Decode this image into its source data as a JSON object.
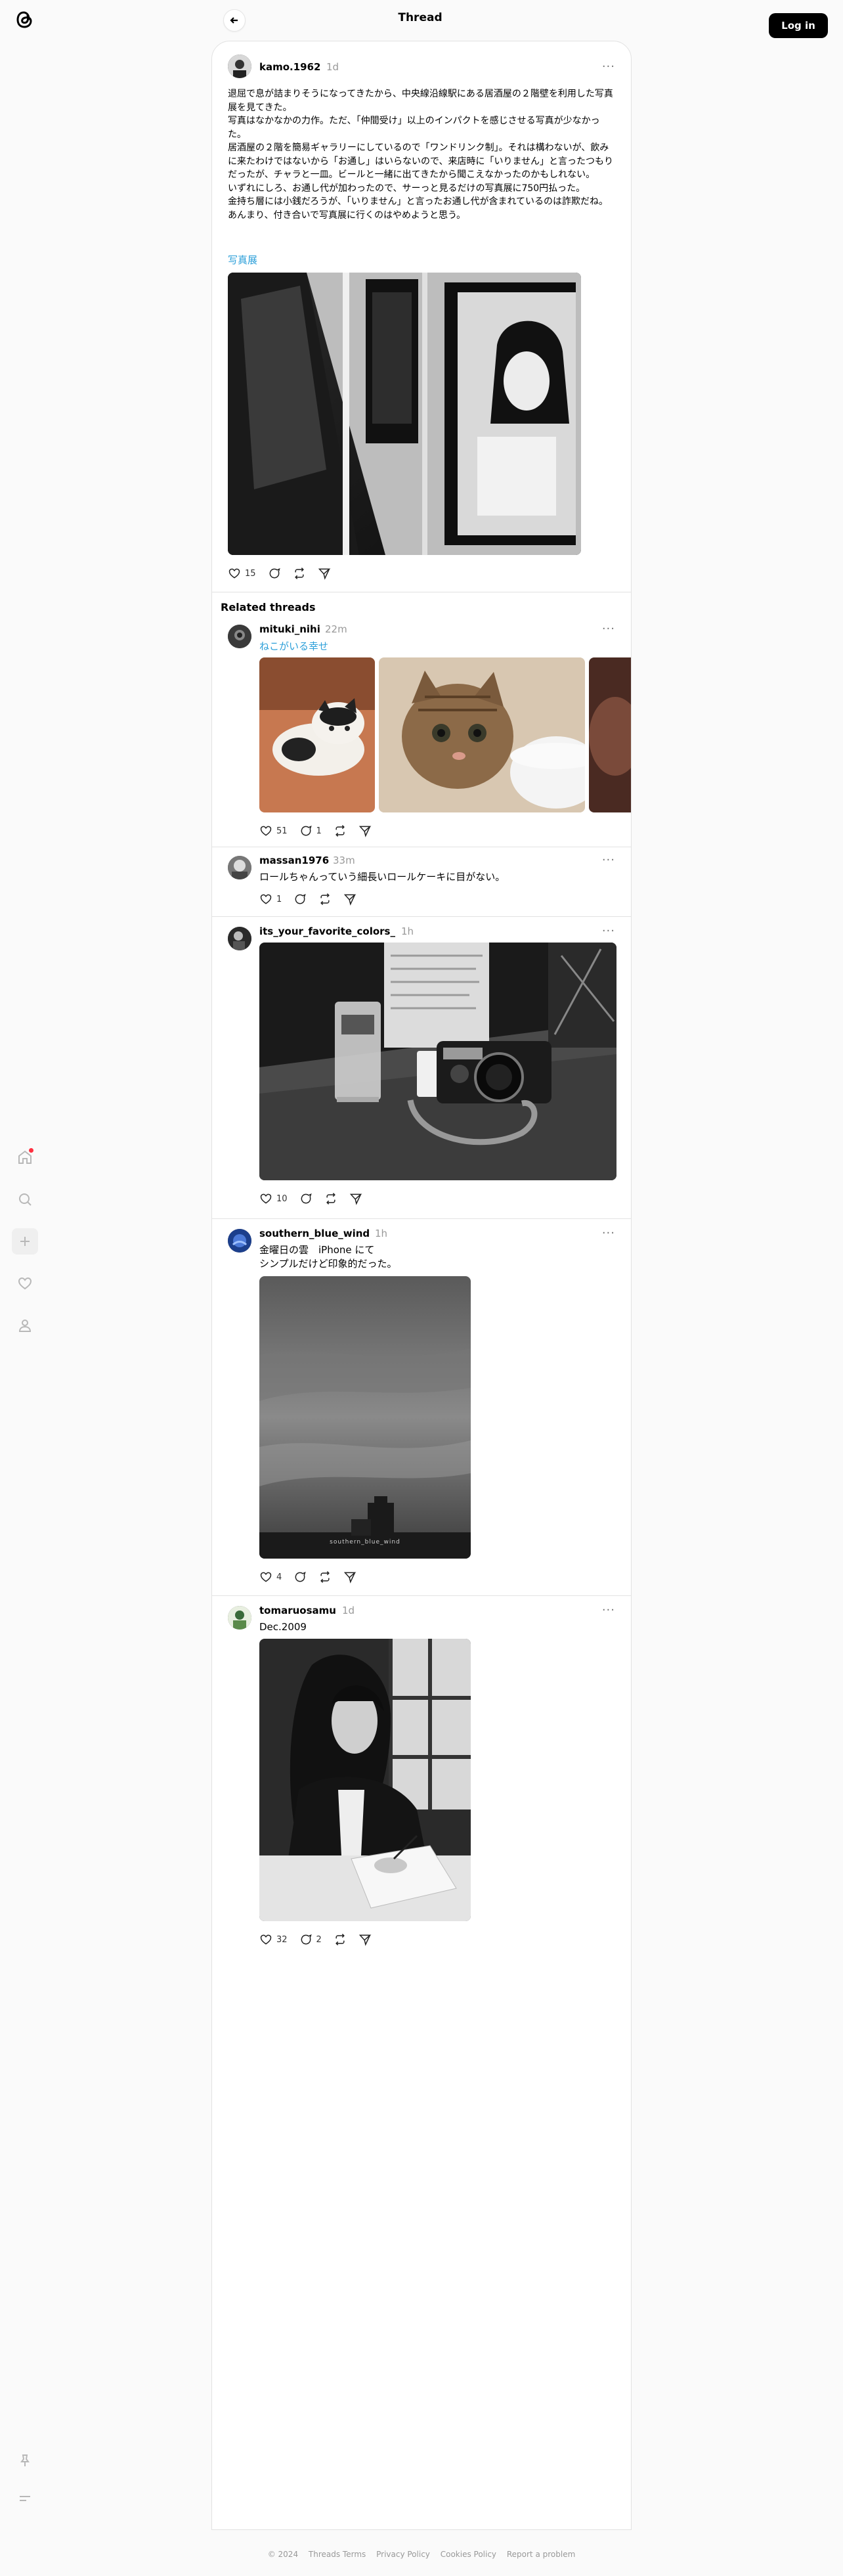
{
  "header": {
    "title": "Thread",
    "login_label": "Log in"
  },
  "rail": {
    "items": [
      "home-icon",
      "search-icon",
      "plus-icon",
      "heart-icon",
      "profile-icon"
    ],
    "bottom": [
      "pin-icon",
      "menu-icon"
    ]
  },
  "main_post": {
    "username": "kamo.1962",
    "time": "1d",
    "text": "退屈で息が詰まりそうになってきたから、中央線沿線駅にある居酒屋の２階壁を利用した写真展を見てきた。\n写真はなかなかの力作。ただ、「仲間受け」以上のインパクトを感じさせる写真が少なかった。\n居酒屋の２階を簡易ギャラリーにしているので「ワンドリンク制」。それは構わないが、飲みに来たわけではないから「お通し」はいらないので、来店時に「いりません」と言ったつもりだったが、チャラと一皿。ビールと一緒に出てきたから聞こえなかったのかもしれない。\nいずれにしろ、お通し代が加わったので、サーっと見るだけの写真展に750円払った。\n金持ち層には小銭だろうが、「いりません」と言ったお通し代が含まれているのは詐欺だね。\nあんまり、付き合いで写真展に行くのはやめようと思う。",
    "tag": "写真展",
    "likes": "15"
  },
  "related": {
    "title": "Related threads",
    "posts": [
      {
        "username": "mituki_nihi",
        "time": "22m",
        "tag": "ねこがいる幸せ",
        "likes": "51",
        "replies": "1"
      },
      {
        "username": "massan1976",
        "time": "33m",
        "text": "ロールちゃんっていう細長いロールケーキに目がない。",
        "likes": "1"
      },
      {
        "username": "its_your_favorite_colors_",
        "time": "1h",
        "likes": "10"
      },
      {
        "username": "southern_blue_wind",
        "time": "1h",
        "text": "金曜日の雲　iPhone にて\nシンプルだけど印象的だった。",
        "likes": "4",
        "watermark": "southern_blue_wind"
      },
      {
        "username": "tomaruosamu",
        "time": "1d",
        "text": "Dec.2009",
        "likes": "32",
        "replies": "2"
      }
    ]
  },
  "footer": {
    "copyright": "© 2024",
    "links": [
      "Threads Terms",
      "Privacy Policy",
      "Cookies Policy",
      "Report a problem"
    ]
  },
  "colors": {
    "accent": "#2b9fd9",
    "notification": "#ff3040"
  }
}
